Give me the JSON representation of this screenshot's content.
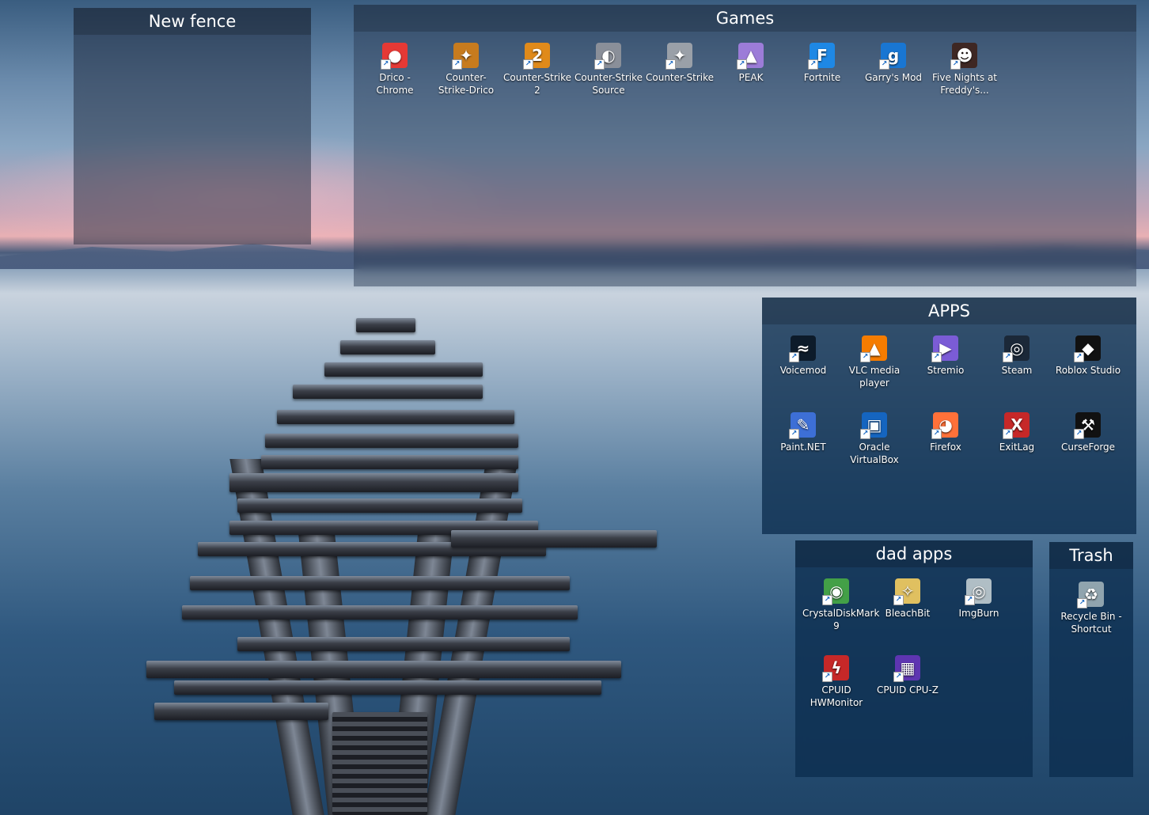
{
  "fences": {
    "new_fence": {
      "title": "New fence"
    },
    "games": {
      "title": "Games",
      "icons": [
        {
          "label": "Drico - Chrome",
          "icon": "chrome-icon",
          "color": "#e53935"
        },
        {
          "label": "Counter-Strike-Drico",
          "icon": "counter-strike-icon",
          "color": "#c77b1e"
        },
        {
          "label": "Counter-Strike 2",
          "icon": "counter-strike-2-icon",
          "color": "#e08a1a"
        },
        {
          "label": "Counter-Strike Source",
          "icon": "counter-strike-source-icon",
          "color": "#8a8f99"
        },
        {
          "label": "Counter-Strike",
          "icon": "counter-strike-icon",
          "color": "#9aa0a8"
        },
        {
          "label": "PEAK",
          "icon": "peak-icon",
          "color": "#9c7cd8"
        },
        {
          "label": "Fortnite",
          "icon": "fortnite-icon",
          "color": "#1e88e5"
        },
        {
          "label": "Garry's Mod",
          "icon": "garrys-mod-icon",
          "color": "#1976d2"
        },
        {
          "label": "Five Nights at Freddy's...",
          "icon": "fnaf-icon",
          "color": "#3e2723"
        }
      ]
    },
    "apps": {
      "title": "APPS",
      "icons": [
        {
          "label": "Voicemod",
          "icon": "voicemod-icon",
          "color": "#0d1b2a"
        },
        {
          "label": "VLC media player",
          "icon": "vlc-icon",
          "color": "#f57c00"
        },
        {
          "label": "Stremio",
          "icon": "stremio-icon",
          "color": "#7b5cd6"
        },
        {
          "label": "Steam",
          "icon": "steam-icon",
          "color": "#1b2838"
        },
        {
          "label": "Roblox Studio",
          "icon": "roblox-studio-icon",
          "color": "#111111"
        },
        {
          "label": "Paint.NET",
          "icon": "paint-net-icon",
          "color": "#3d6fd6"
        },
        {
          "label": "Oracle VirtualBox",
          "icon": "virtualbox-icon",
          "color": "#1565c0"
        },
        {
          "label": "Firefox",
          "icon": "firefox-icon",
          "color": "#ff7139"
        },
        {
          "label": "ExitLag",
          "icon": "exitlag-icon",
          "color": "#c62828"
        },
        {
          "label": "CurseForge",
          "icon": "curseforge-icon",
          "color": "#111111"
        }
      ]
    },
    "dad_apps": {
      "title": "dad apps",
      "icons": [
        {
          "label": "CrystalDiskMark 9",
          "icon": "crystaldiskmark-icon",
          "color": "#43a047"
        },
        {
          "label": "BleachBit",
          "icon": "bleachbit-icon",
          "color": "#e0c060"
        },
        {
          "label": "ImgBurn",
          "icon": "imgburn-icon",
          "color": "#b0bec5"
        },
        {
          "label": "CPUID HWMonitor",
          "icon": "hwmonitor-icon",
          "color": "#c62828"
        },
        {
          "label": "CPUID CPU-Z",
          "icon": "cpu-z-icon",
          "color": "#5e35b1"
        }
      ]
    },
    "trash": {
      "title": "Trash",
      "icons": [
        {
          "label": "Recycle Bin - Shortcut",
          "icon": "recycle-bin-icon",
          "color": "#90a4ae"
        }
      ]
    }
  }
}
